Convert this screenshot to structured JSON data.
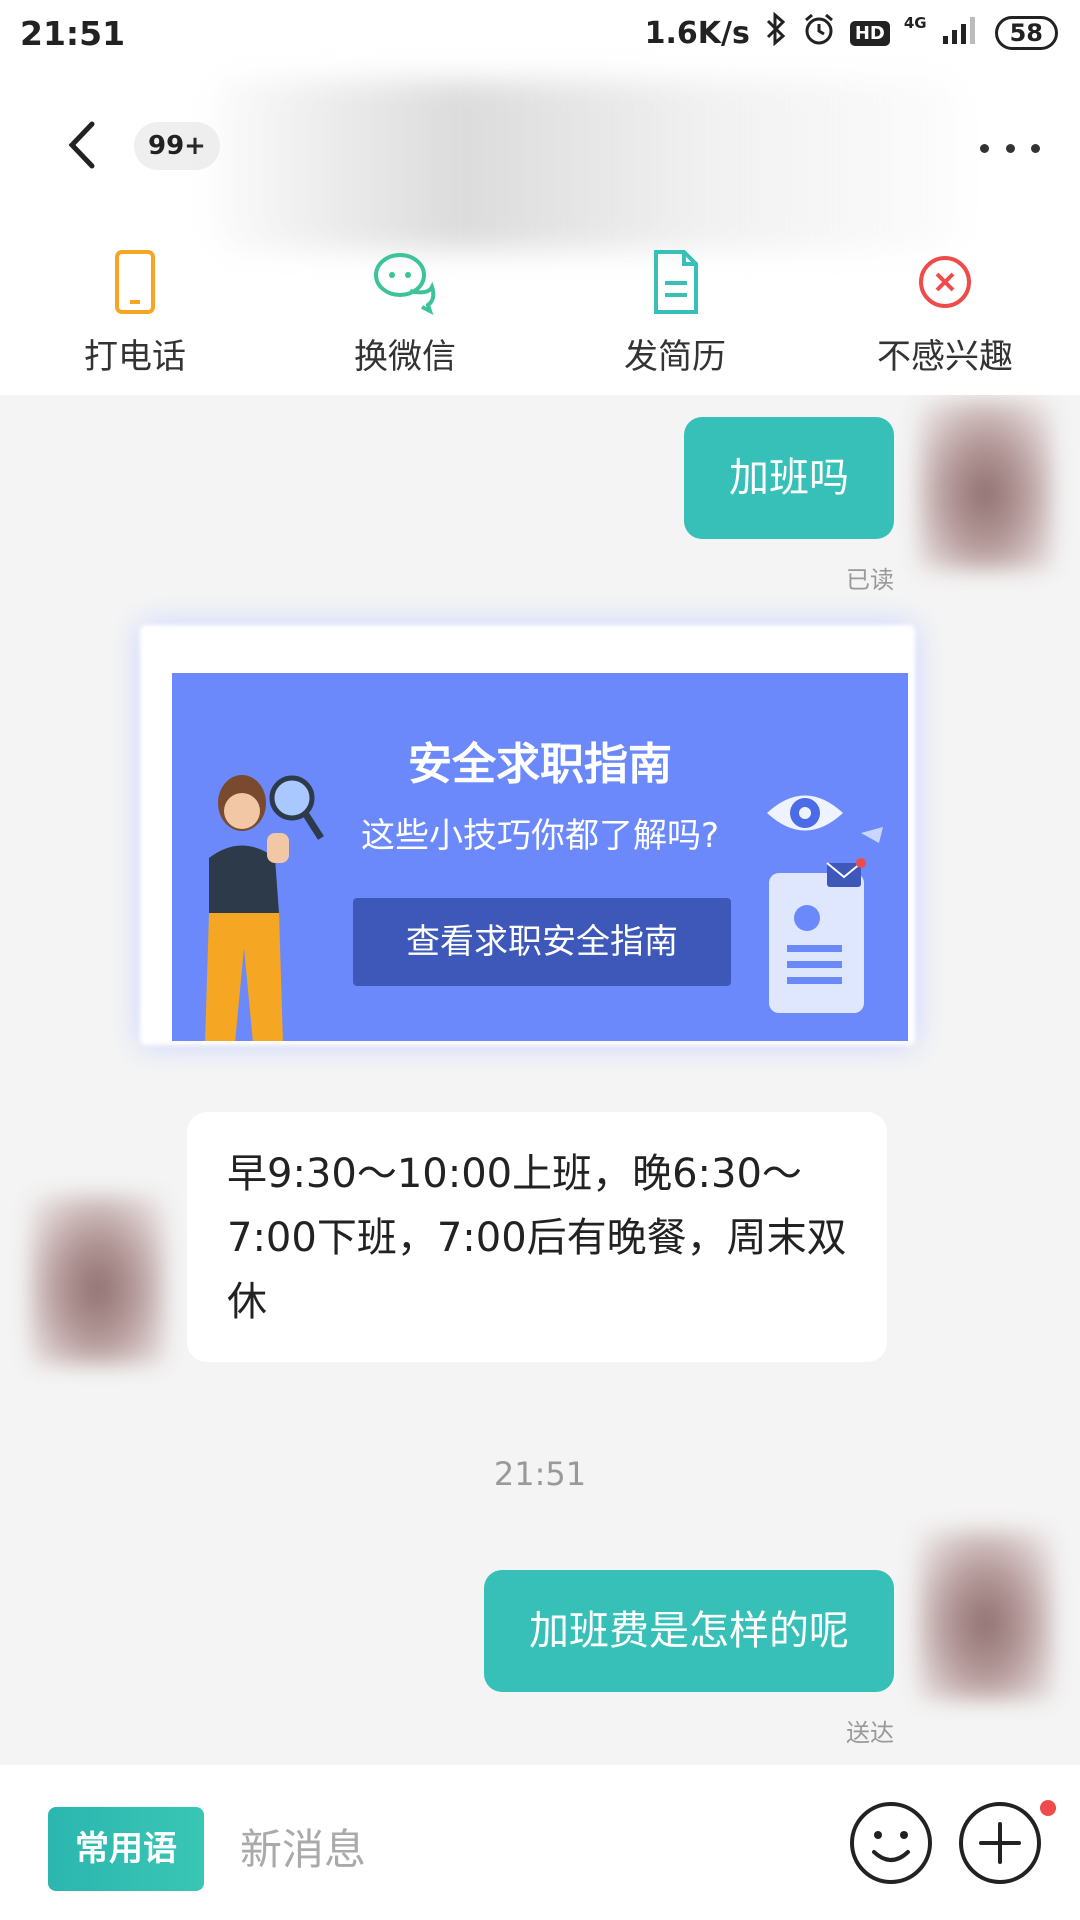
{
  "status_bar": {
    "time": "21:51",
    "network_speed": "1.6K/s",
    "hd": "HD",
    "network_type": "4G",
    "battery": "58"
  },
  "header": {
    "unread_badge": "99+",
    "actions": [
      {
        "label": "打电话",
        "icon": "phone-icon",
        "color": "#f5a623"
      },
      {
        "label": "换微信",
        "icon": "wechat-icon",
        "color": "#3cc39a"
      },
      {
        "label": "发简历",
        "icon": "resume-icon",
        "color": "#36c0b7"
      },
      {
        "label": "不感兴趣",
        "icon": "not-interested-icon",
        "color": "#f04b4b"
      }
    ]
  },
  "messages": [
    {
      "from": "me",
      "text": "加班吗",
      "status": "已读"
    },
    {
      "type": "banner",
      "title": "安全求职指南",
      "subtitle": "这些小技巧你都了解吗?",
      "button": "查看求职安全指南"
    },
    {
      "from": "them",
      "text": "早9:30～10:00上班，晚6:30～7:00下班，7:00后有晚餐，周末双休"
    },
    {
      "type": "time",
      "text": "21:51"
    },
    {
      "from": "me",
      "text": "加班费是怎样的呢",
      "status": "送达"
    }
  ],
  "input_bar": {
    "quick_reply_label": "常用语",
    "placeholder": "新消息"
  },
  "colors": {
    "accent": "#36c0b7",
    "banner_bg": "#6b89fb",
    "banner_button": "#3e58b9",
    "notification_dot": "#f04b4b"
  }
}
